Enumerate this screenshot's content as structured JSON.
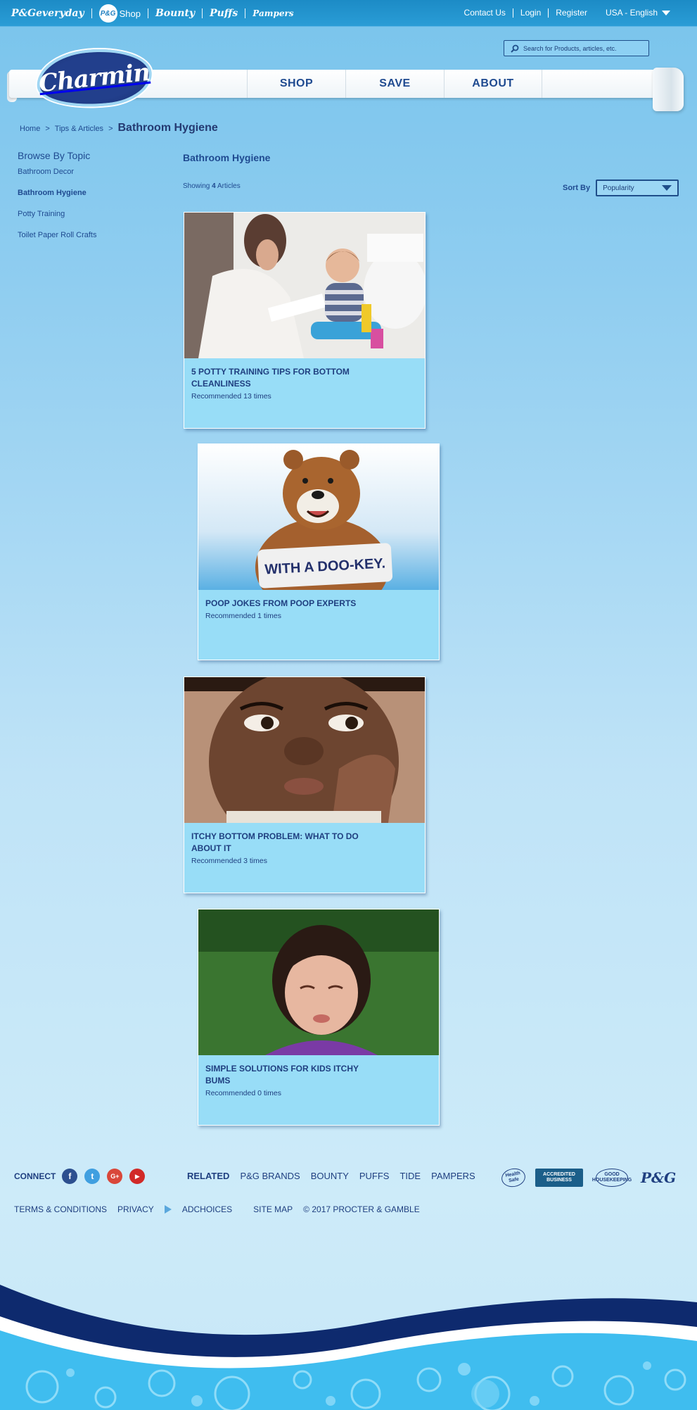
{
  "topbar": {
    "brands": {
      "pg_everyday": "P&Geveryday",
      "pg_shop_circle": "P&G",
      "pg_shop_label": "Shop",
      "bounty": "Bounty",
      "puffs": "Puffs",
      "pampers": "Pampers"
    },
    "links": {
      "contact": "Contact Us",
      "login": "Login",
      "register": "Register",
      "language": "USA - English"
    }
  },
  "search": {
    "placeholder": "Search for Products, articles, etc."
  },
  "logo": {
    "text": "Charmin"
  },
  "nav": {
    "shop": "SHOP",
    "save": "SAVE",
    "about": "ABOUT"
  },
  "breadcrumb": {
    "home": "Home",
    "sep1": ">",
    "tips": "Tips & Articles",
    "sep2": ">",
    "current": "Bathroom Hygiene"
  },
  "sidebar": {
    "heading": "Browse By Topic",
    "items": [
      {
        "label": "Bathroom Decor"
      },
      {
        "label": "Bathroom Hygiene"
      },
      {
        "label": "Potty Training"
      },
      {
        "label": "Toilet Paper Roll Crafts"
      }
    ]
  },
  "main": {
    "title": "Bathroom Hygiene",
    "showing_prefix": "Showing",
    "showing_count": "4",
    "showing_suffix": "Articles",
    "sort_label": "Sort By",
    "sort_value": "Popularity",
    "cards": [
      {
        "title": "5 POTTY TRAINING TIPS FOR BOTTOM CLEANLINESS",
        "recommended": "Recommended 13 times"
      },
      {
        "title": "POOP JOKES FROM POOP EXPERTS",
        "recommended": "Recommended 1 times",
        "image_text": "WITH A DOO-KEY."
      },
      {
        "title": "ITCHY BOTTOM PROBLEM: WHAT TO DO ABOUT IT",
        "recommended": "Recommended 3 times"
      },
      {
        "title": "SIMPLE SOLUTIONS FOR KIDS ITCHY BUMS",
        "recommended": "Recommended 0 times"
      }
    ]
  },
  "footer": {
    "connect_label": "CONNECT",
    "social": {
      "facebook": "f",
      "twitter": "t",
      "google": "G+",
      "youtube": "▶"
    },
    "related_label": "RELATED",
    "related": [
      "P&G BRANDS",
      "BOUNTY",
      "PUFFS",
      "TIDE",
      "PAMPERS"
    ],
    "badges": {
      "healthy": "Health Safe",
      "bbb": "ACCREDITED BUSINESS",
      "housekeeping": "GOOD HOUSEKEEPING",
      "pg": "P&G"
    },
    "legal": {
      "terms": "TERMS & CONDITIONS",
      "privacy": "PRIVACY",
      "adchoices": "ADCHOICES",
      "sitemap": "SITE MAP",
      "copyright": "© 2017 PROCTER & GAMBLE"
    }
  },
  "colors": {
    "brand_navy": "#1f3f80",
    "topbar": "#1c8bc6",
    "card_bg": "#98ddf7"
  }
}
